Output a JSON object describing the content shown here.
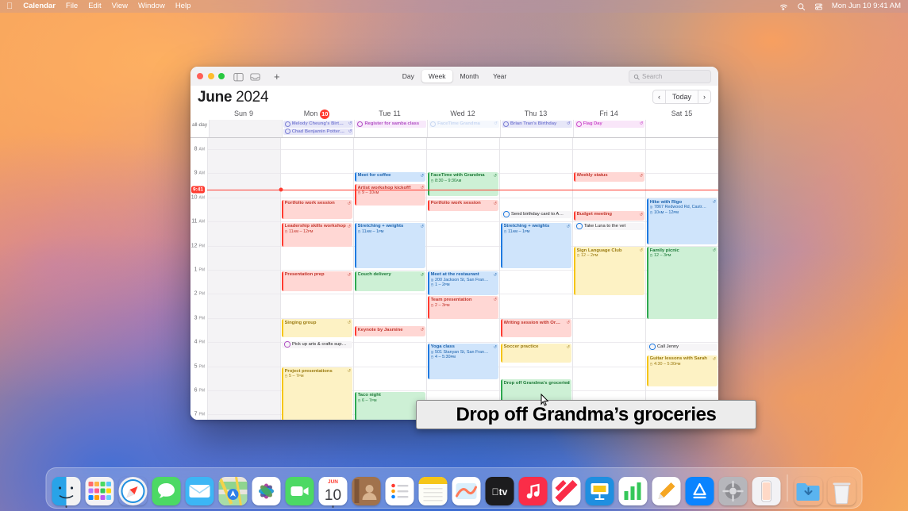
{
  "menubar": {
    "apple": "apple-logo",
    "items": [
      "Calendar",
      "File",
      "Edit",
      "View",
      "Window",
      "Help"
    ],
    "status_icons": [
      "wifi-icon",
      "search-icon",
      "control-center-icon"
    ],
    "clock": "Mon Jun 10  9:41 AM"
  },
  "window": {
    "toolbar": {
      "sidebar_icon": "calendar-sidebar-icon",
      "inbox_icon": "inbox-icon",
      "add_icon": "+",
      "views": [
        {
          "label": "Day",
          "selected": false
        },
        {
          "label": "Week",
          "selected": true
        },
        {
          "label": "Month",
          "selected": false
        },
        {
          "label": "Year",
          "selected": false
        }
      ],
      "search_placeholder": "Search"
    },
    "title": {
      "month": "June",
      "year": "2024"
    },
    "nav": {
      "prev": "‹",
      "today": "Today",
      "next": "›"
    }
  },
  "days": [
    {
      "name": "Sun",
      "num": "9",
      "today": false
    },
    {
      "name": "Mon",
      "num": "10",
      "today": true
    },
    {
      "name": "Tue",
      "num": "11",
      "today": false
    },
    {
      "name": "Wed",
      "num": "12",
      "today": false
    },
    {
      "name": "Thu",
      "num": "13",
      "today": false
    },
    {
      "name": "Fri",
      "num": "14",
      "today": false
    },
    {
      "name": "Sat",
      "num": "15",
      "today": false
    }
  ],
  "allday": {
    "label": "all-day",
    "columns": [
      [],
      [
        {
          "title": "Melody Cheung's Birt…",
          "color": "#7b7fd4",
          "bg": "#e7e7f8",
          "repeat": true,
          "ring": true
        },
        {
          "title": "Chad Benjamin Potter…",
          "color": "#7b7fd4",
          "bg": "#e7e7f8",
          "repeat": true,
          "ring": true
        }
      ],
      [
        {
          "title": "Register for samba class",
          "color": "#b14fc4",
          "bg": "#f8e9fb",
          "repeat": false,
          "ring": true
        }
      ],
      [
        {
          "title": "FaceTime Grandma",
          "color": "#9db8e8",
          "bg": "#eef3fc",
          "repeat": true,
          "ring": true,
          "dim": true
        }
      ],
      [
        {
          "title": "Brian Tran's Birthday",
          "color": "#7b7fd4",
          "bg": "#e7e7f8",
          "repeat": true,
          "ring": true
        }
      ],
      [
        {
          "title": "Flag Day",
          "color": "#cc4fcc",
          "bg": "#f9e6f9",
          "repeat": true,
          "ring": true
        }
      ],
      []
    ]
  },
  "hours": [
    {
      "h": "8",
      "ap": "AM"
    },
    {
      "h": "9",
      "ap": "AM"
    },
    {
      "h": "10",
      "ap": "AM"
    },
    {
      "h": "11",
      "ap": "AM"
    },
    {
      "h": "12",
      "ap": "PM"
    },
    {
      "h": "1",
      "ap": "PM"
    },
    {
      "h": "2",
      "ap": "PM"
    },
    {
      "h": "3",
      "ap": "PM"
    },
    {
      "h": "4",
      "ap": "PM"
    },
    {
      "h": "5",
      "ap": "PM"
    },
    {
      "h": "6",
      "ap": "PM"
    },
    {
      "h": "7",
      "ap": "PM"
    }
  ],
  "now": {
    "label": "9:41",
    "day_index": 1,
    "hour": 9.68
  },
  "events": [
    {
      "day": 1,
      "start": 10.1,
      "end": 10.95,
      "title": "Portfolio work session",
      "time": "",
      "loc": "",
      "color": "#ff3b30",
      "bg": "#ffd7d4",
      "text": "#c2352c",
      "repeat": true
    },
    {
      "day": 1,
      "start": 11.05,
      "end": 12.1,
      "title": "Leadership skills workshop",
      "time": "11ᴀᴍ – 12ᴘᴍ",
      "loc": "",
      "color": "#ff3b30",
      "bg": "#ffd7d4",
      "text": "#c2352c",
      "repeat": true
    },
    {
      "day": 1,
      "start": 13.05,
      "end": 13.95,
      "title": "Presentation prep",
      "time": "",
      "loc": "",
      "color": "#ff3b30",
      "bg": "#ffd7d4",
      "text": "#c2352c",
      "repeat": true
    },
    {
      "day": 1,
      "start": 15.05,
      "end": 15.85,
      "title": "Singing group",
      "time": "",
      "loc": "",
      "color": "#f5c518",
      "bg": "#fdf2c4",
      "text": "#9a7a10",
      "repeat": true
    },
    {
      "day": 1,
      "start": 17.05,
      "end": 19.3,
      "title": "Project presentations",
      "time": "5 – 7ᴘᴍ",
      "loc": "",
      "color": "#f5c518",
      "bg": "#fdf2c4",
      "text": "#9a7a10",
      "repeat": true
    },
    {
      "day": 1,
      "start": 15.95,
      "end": 16.35,
      "title": "Pick up arts & crafts sup…",
      "todo": true,
      "color": "#b14fc4"
    },
    {
      "day": 2,
      "start": 8.95,
      "end": 9.4,
      "title": "Meet for coffee",
      "time": "",
      "loc": "",
      "color": "#1f7ae0",
      "bg": "#cfe4fb",
      "text": "#1b62ad",
      "repeat": true
    },
    {
      "day": 2,
      "start": 9.45,
      "end": 10.4,
      "title": "Artist workshop kickoff!",
      "time": "9 – 10ᴀᴍ",
      "loc": "",
      "color": "#ff3b30",
      "bg": "#ffd7d4",
      "text": "#c2352c",
      "repeat": true
    },
    {
      "day": 2,
      "start": 11.05,
      "end": 13.0,
      "title": "Stretching + weights",
      "time": "11ᴀᴍ – 1ᴘᴍ",
      "loc": "",
      "color": "#1f7ae0",
      "bg": "#cfe4fb",
      "text": "#1b62ad",
      "repeat": true
    },
    {
      "day": 2,
      "start": 13.05,
      "end": 13.95,
      "title": "Couch delivery",
      "time": "",
      "loc": "",
      "color": "#2ea84f",
      "bg": "#cdf0d5",
      "text": "#1d7a38",
      "repeat": true
    },
    {
      "day": 2,
      "start": 15.35,
      "end": 15.8,
      "title": "Keynote by Jasmine",
      "time": "",
      "loc": "",
      "color": "#ff3b30",
      "bg": "#ffd7d4",
      "text": "#c2352c",
      "repeat": true
    },
    {
      "day": 2,
      "start": 18.05,
      "end": 19.3,
      "title": "Taco night",
      "time": "6 – 7ᴘᴍ",
      "loc": "",
      "color": "#2ea84f",
      "bg": "#cdf0d5",
      "text": "#1d7a38",
      "repeat": false
    },
    {
      "day": 3,
      "start": 8.95,
      "end": 10.0,
      "title": "FaceTime with Grandma",
      "time": "8:30 – 9:30ᴀᴍ",
      "loc": "",
      "color": "#2ea84f",
      "bg": "#cdf0d5",
      "text": "#1d7a38",
      "repeat": true
    },
    {
      "day": 3,
      "start": 10.1,
      "end": 10.6,
      "title": "Portfolio work session",
      "time": "",
      "loc": "",
      "color": "#ff3b30",
      "bg": "#ffd7d4",
      "text": "#c2352c",
      "repeat": true
    },
    {
      "day": 3,
      "start": 13.05,
      "end": 14.1,
      "title": "Meet at the restaurant",
      "time": "1 – 2ᴘᴍ",
      "loc": "200 Jackson St, San Fran…",
      "color": "#1f7ae0",
      "bg": "#cfe4fb",
      "text": "#1b62ad",
      "repeat": true
    },
    {
      "day": 3,
      "start": 14.1,
      "end": 15.1,
      "title": "Team presentation",
      "time": "2 – 3ᴘᴍ",
      "loc": "",
      "color": "#ff3b30",
      "bg": "#ffd7d4",
      "text": "#c2352c",
      "repeat": true
    },
    {
      "day": 3,
      "start": 16.05,
      "end": 17.6,
      "title": "Yoga class",
      "time": "4 – 5:30ᴘᴍ",
      "loc": "501 Stanyan St, San Fran…",
      "color": "#1f7ae0",
      "bg": "#cfe4fb",
      "text": "#1b62ad",
      "repeat": true
    },
    {
      "day": 4,
      "start": 10.55,
      "end": 11.0,
      "title": "Send birthday card to A…",
      "todo": true,
      "color": "#1f7ae0"
    },
    {
      "day": 4,
      "start": 11.05,
      "end": 13.0,
      "title": "Stretching + weights",
      "time": "11ᴀᴍ – 1ᴘᴍ",
      "loc": "",
      "color": "#1f7ae0",
      "bg": "#cfe4fb",
      "text": "#1b62ad",
      "repeat": true
    },
    {
      "day": 4,
      "start": 15.05,
      "end": 15.85,
      "title": "Writing session with Or…",
      "time": "",
      "loc": "",
      "color": "#ff3b30",
      "bg": "#ffd7d4",
      "text": "#c2352c",
      "repeat": true
    },
    {
      "day": 4,
      "start": 16.05,
      "end": 16.9,
      "title": "Soccer practice",
      "time": "",
      "loc": "",
      "color": "#f5c518",
      "bg": "#fdf2c4",
      "text": "#9a7a10",
      "repeat": true
    },
    {
      "day": 4,
      "start": 17.55,
      "end": 19.3,
      "title": "Drop off Grandma's groceries",
      "time": "",
      "loc": "",
      "color": "#2ea84f",
      "bg": "#cdf0d5",
      "text": "#1d7a38",
      "repeat": true
    },
    {
      "day": 5,
      "start": 8.95,
      "end": 9.4,
      "title": "Weekly status",
      "time": "",
      "loc": "",
      "color": "#ff3b30",
      "bg": "#ffd7d4",
      "text": "#c2352c",
      "repeat": true
    },
    {
      "day": 5,
      "start": 10.55,
      "end": 11.0,
      "title": "Budget meeting",
      "time": "",
      "loc": "",
      "color": "#ff3b30",
      "bg": "#ffd7d4",
      "text": "#c2352c",
      "repeat": true
    },
    {
      "day": 5,
      "start": 11.05,
      "end": 11.5,
      "title": "Take Luna to the vet",
      "todo": true,
      "color": "#1f7ae0"
    },
    {
      "day": 5,
      "start": 12.05,
      "end": 14.1,
      "title": "Sign Language Club",
      "time": "12 – 2ᴘᴍ",
      "loc": "",
      "color": "#f5c518",
      "bg": "#fdf2c4",
      "text": "#9a7a10",
      "repeat": true
    },
    {
      "day": 6,
      "start": 10.05,
      "end": 12.0,
      "title": "Hike with Rigo",
      "time": "10ᴀᴍ – 12ᴘᴍ",
      "loc": "7867 Redwood Rd, Castr…",
      "color": "#1f7ae0",
      "bg": "#cfe4fb",
      "text": "#1b62ad",
      "repeat": true
    },
    {
      "day": 6,
      "start": 12.05,
      "end": 15.1,
      "title": "Family picnic",
      "time": "12 – 3ᴘᴍ",
      "loc": "",
      "color": "#2ea84f",
      "bg": "#cdf0d5",
      "text": "#1d7a38",
      "repeat": true
    },
    {
      "day": 6,
      "start": 16.05,
      "end": 16.5,
      "title": "Call Jenny",
      "todo": true,
      "color": "#1f7ae0"
    },
    {
      "day": 6,
      "start": 16.55,
      "end": 17.9,
      "title": "Guitar lessons with Sarah",
      "time": "4:30 – 5:30ᴘᴍ",
      "loc": "",
      "color": "#f5c518",
      "bg": "#fdf2c4",
      "text": "#9a7a10",
      "repeat": true
    }
  ],
  "caption": "Drop off Grandma’s groceries",
  "dock": {
    "items": [
      {
        "name": "finder",
        "running": true
      },
      {
        "name": "launchpad",
        "running": false
      },
      {
        "name": "safari",
        "running": false
      },
      {
        "name": "messages",
        "running": false
      },
      {
        "name": "mail",
        "running": false
      },
      {
        "name": "maps",
        "running": false
      },
      {
        "name": "photos",
        "running": false
      },
      {
        "name": "facetime",
        "running": false
      },
      {
        "name": "calendar",
        "running": true,
        "month": "JUN",
        "day": "10"
      },
      {
        "name": "contacts",
        "running": false
      },
      {
        "name": "reminders",
        "running": false
      },
      {
        "name": "notes",
        "running": false
      },
      {
        "name": "freeform",
        "running": false
      },
      {
        "name": "apple-tv",
        "running": false
      },
      {
        "name": "music",
        "running": false
      },
      {
        "name": "news",
        "running": false
      },
      {
        "name": "keynote",
        "running": false
      },
      {
        "name": "numbers",
        "running": false
      },
      {
        "name": "pages",
        "running": false
      },
      {
        "name": "app-store",
        "running": false
      },
      {
        "name": "system-settings",
        "running": false
      },
      {
        "name": "iphone-mirroring",
        "running": false
      }
    ],
    "downloads": "downloads-folder",
    "trash": "trash"
  }
}
